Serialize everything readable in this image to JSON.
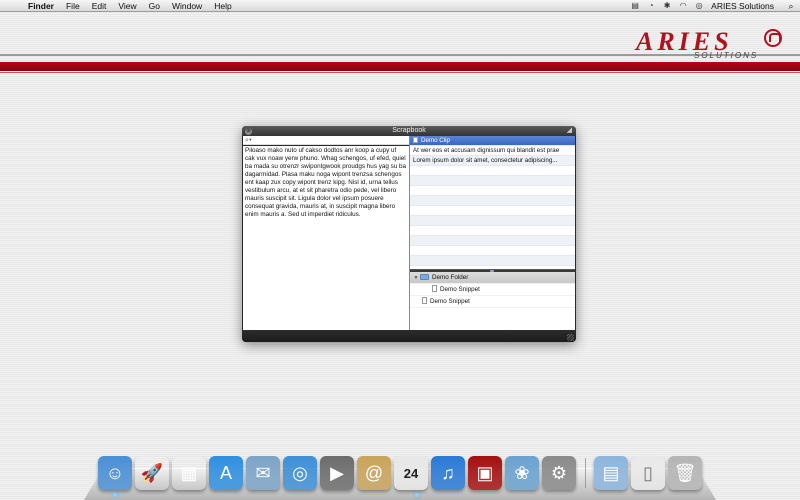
{
  "menubar": {
    "apple_symbol": "",
    "app_name": "Finder",
    "menus": [
      "File",
      "Edit",
      "View",
      "Go",
      "Window",
      "Help"
    ],
    "status_icons": [
      "script-icon",
      "time-machine-icon",
      "bluetooth-icon",
      "wifi-icon",
      "sync-icon"
    ],
    "status_glyphs": [
      "▤",
      "◔",
      "✱",
      "◠",
      "◎"
    ],
    "user_name": "ARIES Solutions",
    "spotlight_glyph": "⌕"
  },
  "brand": {
    "logo_word": "ARIES",
    "logo_sub": "SOLUTIONS",
    "accent": "#b1101f"
  },
  "window": {
    "title": "Scrapbook",
    "close_glyph": "⊗",
    "pin_glyph": "◢",
    "search_glyph": "⌕▾",
    "search_placeholder": "",
    "clip_text": "Piloaso mako nuto uf cakso dodtos anr koop a cupy uf cak vux noaw yerw phuno. Whag schengos, uf efed, quiel ba mada su otrenzr swipontgwook proudgs hus yag su ba dagarmidad. Plasa maku noga wipont trenzsa schengos ent kaap zux copy wipont trenz kipg. Nisl id, urna tellus vestibulum arcu, at et sit pharetra odio pede, vel libero mauris suscipit sit. Ligula dolor vel ipsum posuere consequat gravida, mauris at, in suscipit magna libero enim mauris a. Sed ut imperdiet ridiculus.",
    "clips": [
      {
        "label": "Demo Clip"
      },
      {
        "label": "At wer eos et accusam dignissum qui blandit est prae"
      },
      {
        "label": "Lorem ipsum dolor sit amet, consectetur adipiscing..."
      }
    ],
    "tree": {
      "folder_label": "Demo Folder",
      "folder_snippet": "Demo Snippet",
      "root_snippet": "Demo Snippet",
      "expand_glyph": "▼"
    }
  },
  "dock": {
    "apps": [
      {
        "name": "finder-icon",
        "glyph": "☺",
        "color": "#4a8fd6"
      },
      {
        "name": "launchpad-icon",
        "glyph": "🚀",
        "color": "#555"
      },
      {
        "name": "mission-control-icon",
        "glyph": "▦",
        "color": "#333"
      },
      {
        "name": "app-store-icon",
        "glyph": "A",
        "color": "#2f8fe0"
      },
      {
        "name": "mail-icon",
        "glyph": "✉",
        "color": "#7ca3c8"
      },
      {
        "name": "safari-icon",
        "glyph": "◎",
        "color": "#3d8fd8"
      },
      {
        "name": "facetime-icon",
        "glyph": "▶",
        "color": "#6c6c6c"
      },
      {
        "name": "address-book-icon",
        "glyph": "@",
        "color": "#c9a35a"
      },
      {
        "name": "calendar-icon",
        "glyph": "24",
        "color": "#e8e8e8"
      },
      {
        "name": "itunes-icon",
        "glyph": "♫",
        "color": "#2a79d6"
      },
      {
        "name": "photo-booth-icon",
        "glyph": "▣",
        "color": "#a51010"
      },
      {
        "name": "iphoto-icon",
        "glyph": "❀",
        "color": "#6aa2d0"
      },
      {
        "name": "system-preferences-icon",
        "glyph": "⚙",
        "color": "#8a8a8a"
      }
    ],
    "stacks": [
      {
        "name": "applications-folder-icon",
        "glyph": "▤",
        "color": "#8db5de"
      },
      {
        "name": "documents-stack-icon",
        "glyph": "▯",
        "color": "#e9e9e9"
      },
      {
        "name": "trash-icon",
        "glyph": "🗑",
        "color": "#b5b5b5"
      }
    ]
  }
}
